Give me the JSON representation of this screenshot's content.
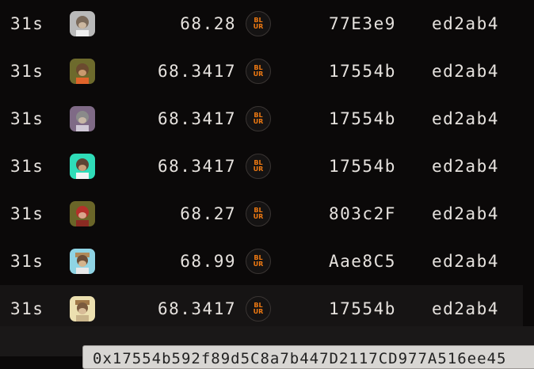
{
  "colors": {
    "background": "#0b0909",
    "text": "#e6e2de",
    "token_accent": "#f07a12",
    "hover_row": "#161414"
  },
  "token": {
    "icon": "blur-token-icon",
    "label_top": "BL",
    "label_bottom": "UR"
  },
  "rows": [
    {
      "age": "31s",
      "avatar": "ape-avatar-grey",
      "price": "68.28",
      "from": "77E3e9",
      "to": "ed2ab4"
    },
    {
      "age": "31s",
      "avatar": "ape-avatar-olive",
      "price": "68.3417",
      "from": "17554b",
      "to": "ed2ab4"
    },
    {
      "age": "31s",
      "avatar": "ape-avatar-purple",
      "price": "68.3417",
      "from": "17554b",
      "to": "ed2ab4"
    },
    {
      "age": "31s",
      "avatar": "ape-avatar-teal",
      "price": "68.3417",
      "from": "17554b",
      "to": "ed2ab4"
    },
    {
      "age": "31s",
      "avatar": "ape-avatar-red",
      "price": "68.27",
      "from": "803c2F",
      "to": "ed2ab4"
    },
    {
      "age": "31s",
      "avatar": "ape-avatar-blue",
      "price": "68.99",
      "from": "Aae8C5",
      "to": "ed2ab4"
    },
    {
      "age": "31s",
      "avatar": "ape-avatar-cream",
      "price": "68.3417",
      "from": "17554b",
      "to": "ed2ab4"
    }
  ],
  "tooltip": {
    "text": "0x17554b592f89d5C8a7b447D2117CD977A516ee45"
  }
}
